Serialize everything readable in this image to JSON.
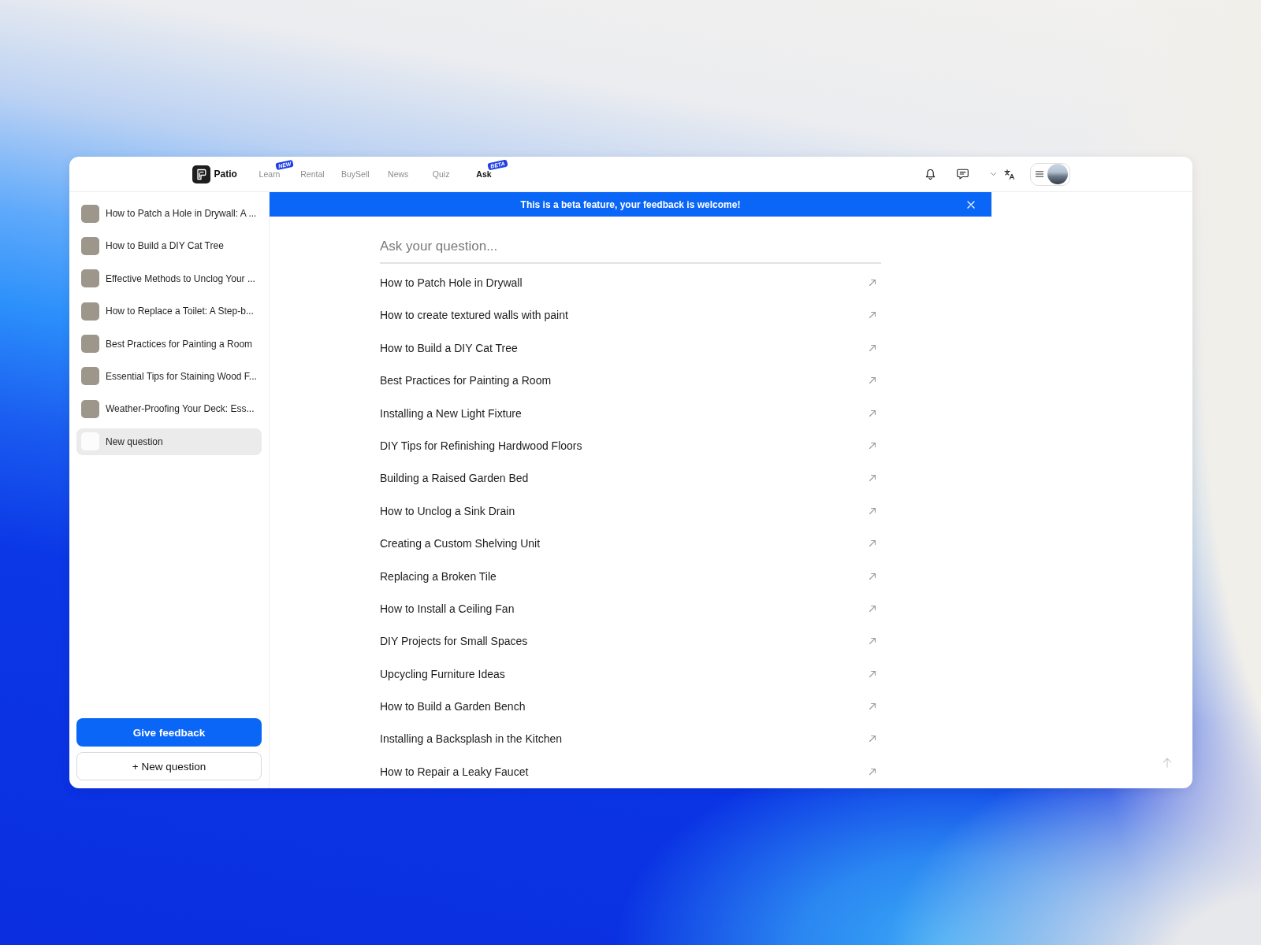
{
  "header": {
    "logo": {
      "text": "Patio"
    },
    "tabs": [
      {
        "label": "Learn",
        "selected": false,
        "badge": "NEW"
      },
      {
        "label": "Rental",
        "selected": false
      },
      {
        "label": "BuySell",
        "selected": false
      },
      {
        "label": "News",
        "selected": false
      },
      {
        "label": "Quiz",
        "selected": false
      },
      {
        "label": "Ask",
        "selected": true,
        "badge": "BETA"
      }
    ]
  },
  "sidebar": {
    "items": [
      {
        "kind": "article",
        "title": "How to Patch a Hole in Drywall: A ...",
        "selected": false
      },
      {
        "kind": "article",
        "title": "How to Build a DIY Cat Tree",
        "selected": false
      },
      {
        "kind": "article",
        "title": "Effective Methods to Unclog Your ...",
        "selected": false
      },
      {
        "kind": "article",
        "title": "How to Replace a Toilet: A Step-b...",
        "selected": false
      },
      {
        "kind": "article",
        "title": "Best Practices for Painting a Room",
        "selected": false
      },
      {
        "kind": "article",
        "title": "Essential Tips for Staining Wood F...",
        "selected": false
      },
      {
        "kind": "article",
        "title": "Weather-Proofing Your Deck: Ess...",
        "selected": false
      },
      {
        "kind": "draft",
        "title": "New question",
        "selected": true
      }
    ],
    "feedback_button": "Give feedback",
    "new_question_button": "+ New question"
  },
  "banner": {
    "text": "This is a beta feature, your feedback is welcome!"
  },
  "search": {
    "placeholder": "Ask your question..."
  },
  "suggestions": [
    "How to Patch Hole in Drywall",
    "How to create textured walls with paint",
    "How to Build a DIY Cat Tree",
    "Best Practices for Painting a Room",
    "Installing a New Light Fixture",
    "DIY Tips for Refinishing Hardwood Floors",
    "Building a Raised Garden Bed",
    "How to Unclog a Sink Drain",
    "Creating a Custom Shelving Unit",
    "Replacing a Broken Tile",
    "How to Install a Ceiling Fan",
    "DIY Projects for Small Spaces",
    "Upcycling Furniture Ideas",
    "How to Build a Garden Bench",
    "Installing a Backsplash in the Kitchen",
    "How to Repair a Leaky Faucet"
  ]
}
